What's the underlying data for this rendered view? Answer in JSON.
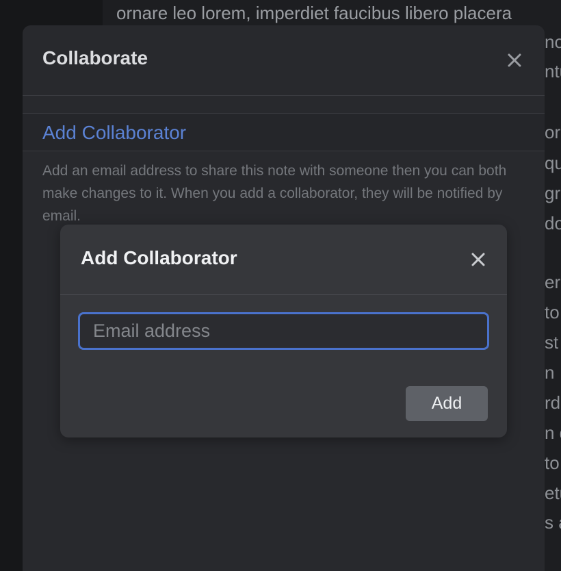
{
  "background": {
    "top_line": "ornare leo lorem, imperdiet faucibus libero placera",
    "right_fragments": [
      "no",
      "ntu",
      "or",
      "qu",
      "gr",
      "do",
      "er",
      "to",
      "st",
      "n",
      "rd",
      "n d",
      "to",
      "etu",
      "s a"
    ]
  },
  "panel": {
    "title": "Collaborate",
    "close_icon": "close-icon",
    "section_link": "Add Collaborator",
    "description": "Add an email address to share this note with someone then you can both make changes to it. When you add a collaborator, they will be notified by email."
  },
  "modal": {
    "title": "Add Collaborator",
    "close_icon": "close-icon",
    "email": {
      "value": "",
      "placeholder": "Email address"
    },
    "add_label": "Add"
  },
  "colors": {
    "background": "#1d1e21",
    "panel": "#28292d",
    "modal": "#36373b",
    "accent": "#4a72cc",
    "link": "#5b82d4",
    "button": "#5e6167"
  }
}
